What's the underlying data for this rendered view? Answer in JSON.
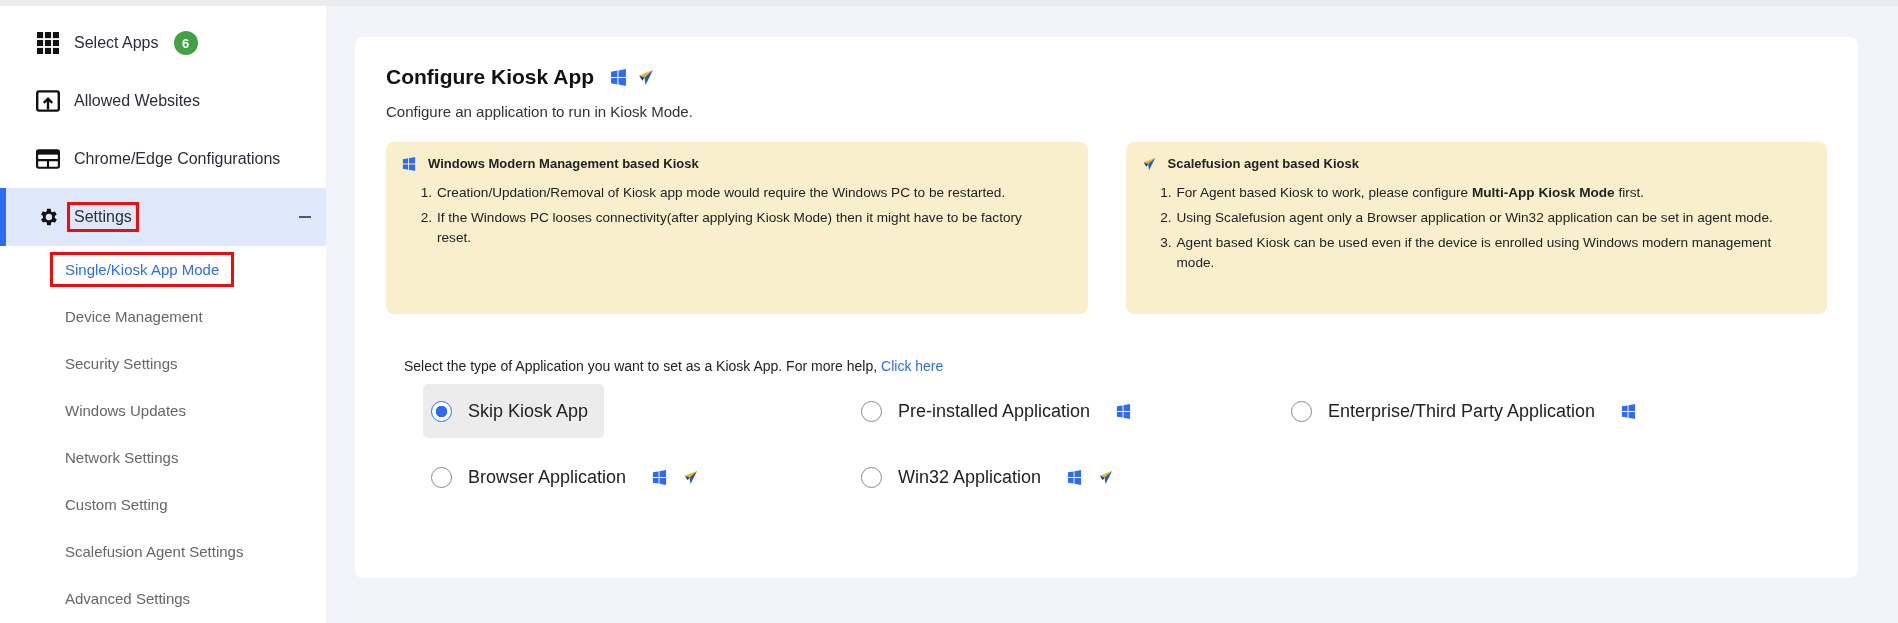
{
  "sidebar": {
    "items": [
      {
        "label": "Select Apps",
        "badge": "6",
        "selected": false,
        "annotated": false
      },
      {
        "label": "Allowed Websites",
        "selected": false,
        "annotated": false
      },
      {
        "label": "Chrome/Edge Configurations",
        "selected": false,
        "annotated": false
      },
      {
        "label": "Settings",
        "selected": true,
        "expanded": true,
        "annotated": true,
        "children": [
          {
            "label": "Single/Kiosk App Mode",
            "selected": true,
            "annotated": true
          },
          {
            "label": "Device Management",
            "selected": false,
            "annotated": false
          },
          {
            "label": "Security Settings",
            "selected": false,
            "annotated": false
          },
          {
            "label": "Windows Updates",
            "selected": false,
            "annotated": false
          },
          {
            "label": "Network Settings",
            "selected": false,
            "annotated": false
          },
          {
            "label": "Custom Setting",
            "selected": false,
            "annotated": false
          },
          {
            "label": "Scalefusion Agent Settings",
            "selected": false,
            "annotated": false
          },
          {
            "label": "Advanced Settings",
            "selected": false,
            "annotated": false
          }
        ]
      }
    ]
  },
  "panel": {
    "title": "Configure Kiosk App",
    "windows_icon": true,
    "agent_icon": true,
    "subtitle": "Configure an application to run in Kiosk Mode.",
    "notes": [
      {
        "kind": "windows",
        "title": "Windows Modern Management based Kiosk",
        "items": [
          {
            "marker": "1.",
            "text": "Creation/Updation/Removal of Kiosk app mode would require the Windows PC to be restarted."
          },
          {
            "marker": "2.",
            "text": "If the Windows PC looses connectivity(after applying Kiosk Mode) then it might have to be factory reset."
          }
        ]
      },
      {
        "kind": "agent",
        "title": "Scalefusion agent based Kiosk",
        "items": [
          {
            "marker": "1.",
            "text": "For Agent based Kiosk to work, please configure **Multi-App Kiosk Mode** first."
          },
          {
            "marker": "2.",
            "text": "Using Scalefusion agent only a Browser application or Win32 application can be set in agent mode."
          },
          {
            "marker": "3.",
            "text": "Agent based Kiosk can be used even if the device is enrolled using Windows modern management mode."
          }
        ]
      }
    ],
    "prompt": "Select the type of Application you want to set as a Kiosk App. For more help,",
    "help_link": "Click here",
    "options": [
      {
        "label": "Skip Kiosk App",
        "selected": true,
        "windows_icon": false,
        "agent_icon": false
      },
      {
        "label": "Pre-installed Application",
        "selected": false,
        "windows_icon": true,
        "agent_icon": false
      },
      {
        "label": "Enterprise/Third Party Application",
        "selected": false,
        "windows_icon": true,
        "agent_icon": false
      },
      {
        "label": "Browser Application",
        "selected": false,
        "windows_icon": true,
        "agent_icon": true
      },
      {
        "label": "Win32 Application",
        "selected": false,
        "windows_icon": true,
        "agent_icon": true
      }
    ]
  }
}
